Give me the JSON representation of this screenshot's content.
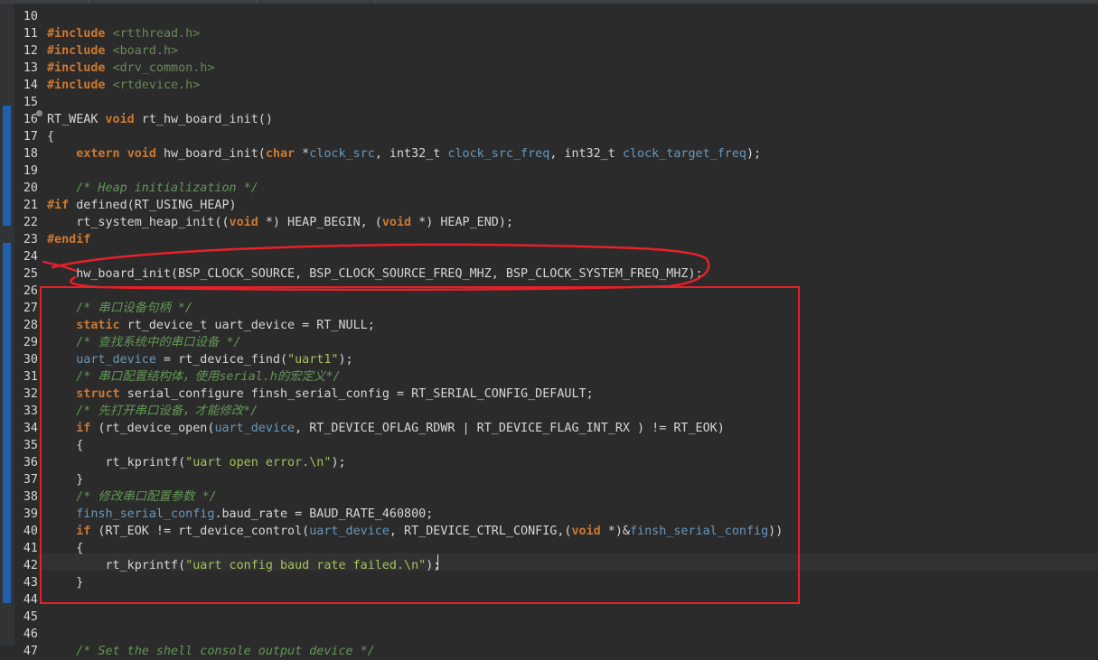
{
  "editor": {
    "lines": [
      {
        "n": "10",
        "parts": []
      },
      {
        "n": "11",
        "parts": [
          [
            "k",
            "#include"
          ],
          [
            "d",
            " "
          ],
          [
            "s",
            "<rtthread.h>"
          ]
        ]
      },
      {
        "n": "12",
        "parts": [
          [
            "k",
            "#include"
          ],
          [
            "d",
            " "
          ],
          [
            "s",
            "<board.h>"
          ]
        ]
      },
      {
        "n": "13",
        "parts": [
          [
            "k",
            "#include"
          ],
          [
            "d",
            " "
          ],
          [
            "s",
            "<drv_common.h>"
          ]
        ]
      },
      {
        "n": "14",
        "parts": [
          [
            "k",
            "#include"
          ],
          [
            "d",
            " "
          ],
          [
            "s",
            "<rtdevice.h>"
          ]
        ]
      },
      {
        "n": "15",
        "parts": []
      },
      {
        "n": "16",
        "parts": [
          [
            "d",
            "RT_WEAK "
          ],
          [
            "k",
            "void"
          ],
          [
            "d",
            " rt_hw_board_init()"
          ]
        ]
      },
      {
        "n": "17",
        "parts": [
          [
            "d",
            "{"
          ]
        ]
      },
      {
        "n": "18",
        "parts": [
          [
            "d",
            "    "
          ],
          [
            "k",
            "extern"
          ],
          [
            "d",
            " "
          ],
          [
            "k",
            "void"
          ],
          [
            "d",
            " hw_board_init("
          ],
          [
            "k",
            "char"
          ],
          [
            "d",
            " *"
          ],
          [
            "v",
            "clock_src"
          ],
          [
            "d",
            ", int32_t "
          ],
          [
            "v",
            "clock_src_freq"
          ],
          [
            "d",
            ", int32_t "
          ],
          [
            "v",
            "clock_target_freq"
          ],
          [
            "d",
            ");"
          ]
        ]
      },
      {
        "n": "19",
        "parts": []
      },
      {
        "n": "20",
        "parts": [
          [
            "d",
            "    "
          ],
          [
            "c",
            "/* Heap initialization */"
          ]
        ]
      },
      {
        "n": "21",
        "parts": [
          [
            "k",
            "#if"
          ],
          [
            "d",
            " defined(RT_USING_HEAP)"
          ]
        ]
      },
      {
        "n": "22",
        "parts": [
          [
            "d",
            "    rt_system_heap_init(("
          ],
          [
            "k",
            "void"
          ],
          [
            "d",
            " *) HEAP_BEGIN, ("
          ],
          [
            "k",
            "void"
          ],
          [
            "d",
            " *) HEAP_END);"
          ]
        ]
      },
      {
        "n": "23",
        "parts": [
          [
            "k",
            "#endif"
          ]
        ]
      },
      {
        "n": "24",
        "parts": []
      },
      {
        "n": "25",
        "parts": [
          [
            "d",
            "    hw_board_init(BSP_CLOCK_SOURCE, BSP_CLOCK_SOURCE_FREQ_MHZ, BSP_CLOCK_SYSTEM_FREQ_MHZ);"
          ]
        ]
      },
      {
        "n": "26",
        "parts": []
      },
      {
        "n": "27",
        "parts": [
          [
            "d",
            "    "
          ],
          [
            "c",
            "/* 串口设备句柄 */"
          ]
        ]
      },
      {
        "n": "28",
        "parts": [
          [
            "d",
            "    "
          ],
          [
            "k",
            "static"
          ],
          [
            "d",
            " rt_device_t uart_device = RT_NULL;"
          ]
        ]
      },
      {
        "n": "29",
        "parts": [
          [
            "d",
            "    "
          ],
          [
            "c",
            "/* 查找系统中的串口设备 */"
          ]
        ]
      },
      {
        "n": "30",
        "parts": [
          [
            "d",
            "    "
          ],
          [
            "v",
            "uart_device"
          ],
          [
            "d",
            " = rt_device_find("
          ],
          [
            "s2",
            "\"uart1\""
          ],
          [
            "d",
            ");"
          ]
        ]
      },
      {
        "n": "31",
        "parts": [
          [
            "d",
            "    "
          ],
          [
            "c",
            "/* 串口配置结构体，使用serial.h的宏定义*/"
          ]
        ]
      },
      {
        "n": "32",
        "parts": [
          [
            "d",
            "    "
          ],
          [
            "k",
            "struct"
          ],
          [
            "d",
            " serial_configure finsh_serial_config = RT_SERIAL_CONFIG_DEFAULT;"
          ]
        ]
      },
      {
        "n": "33",
        "parts": [
          [
            "d",
            "    "
          ],
          [
            "c",
            "/* 先打开串口设备，才能修改*/"
          ]
        ]
      },
      {
        "n": "34",
        "parts": [
          [
            "d",
            "    "
          ],
          [
            "k",
            "if"
          ],
          [
            "d",
            " (rt_device_open("
          ],
          [
            "v",
            "uart_device"
          ],
          [
            "d",
            ", RT_DEVICE_OFLAG_RDWR | RT_DEVICE_FLAG_INT_RX ) != RT_EOK)"
          ]
        ]
      },
      {
        "n": "35",
        "parts": [
          [
            "d",
            "    {"
          ]
        ]
      },
      {
        "n": "36",
        "parts": [
          [
            "d",
            "        rt_kprintf("
          ],
          [
            "s2",
            "\"uart open error.\\n\""
          ],
          [
            "d",
            ");"
          ]
        ]
      },
      {
        "n": "37",
        "parts": [
          [
            "d",
            "    }"
          ]
        ]
      },
      {
        "n": "38",
        "parts": [
          [
            "d",
            "    "
          ],
          [
            "c",
            "/* 修改串口配置参数 */"
          ]
        ]
      },
      {
        "n": "39",
        "parts": [
          [
            "d",
            "    "
          ],
          [
            "v",
            "finsh_serial_config"
          ],
          [
            "d",
            ".baud_rate = BAUD_RATE_460800;"
          ]
        ]
      },
      {
        "n": "40",
        "parts": [
          [
            "d",
            "    "
          ],
          [
            "k",
            "if"
          ],
          [
            "d",
            " (RT_EOK != rt_device_control("
          ],
          [
            "v",
            "uart_device"
          ],
          [
            "d",
            ", RT_DEVICE_CTRL_CONFIG,("
          ],
          [
            "k",
            "void"
          ],
          [
            "d",
            " *)&"
          ],
          [
            "v",
            "finsh_serial_config"
          ],
          [
            "d",
            "))"
          ]
        ]
      },
      {
        "n": "41",
        "parts": [
          [
            "d",
            "    {"
          ]
        ]
      },
      {
        "n": "42",
        "parts": [
          [
            "d",
            "        rt_kprintf("
          ],
          [
            "s2",
            "\"uart config baud rate failed.\\n\""
          ],
          [
            "d",
            ");"
          ]
        ]
      },
      {
        "n": "43",
        "parts": [
          [
            "d",
            "    }"
          ]
        ]
      },
      {
        "n": "44",
        "parts": []
      },
      {
        "n": "45",
        "parts": []
      },
      {
        "n": "46",
        "parts": []
      },
      {
        "n": "47",
        "parts": [
          [
            "d",
            "    "
          ],
          [
            "c",
            "/* Set the shell console output device */"
          ]
        ]
      }
    ]
  },
  "colors": {
    "background": "#2b2b2b",
    "annotation": "#e8202a"
  }
}
